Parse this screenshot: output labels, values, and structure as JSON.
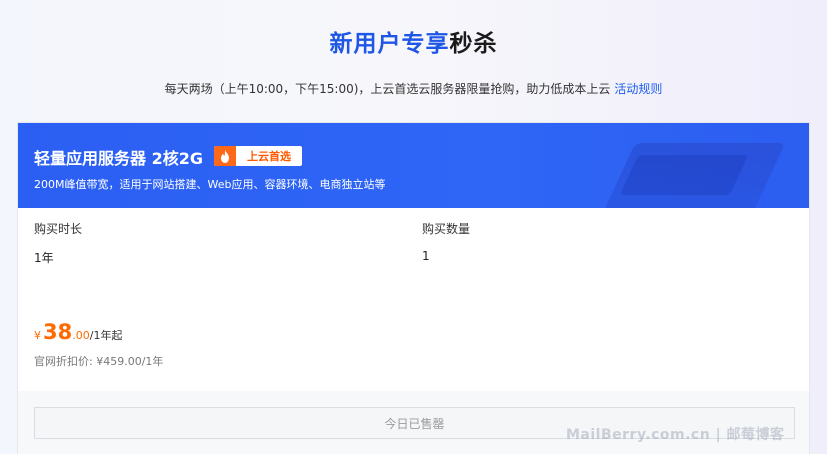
{
  "header": {
    "title_highlight": "新用户专享",
    "title_rest": "秒杀",
    "subtitle": "每天两场（上午10:00，下午15:00)，上云首选云服务器限量抢购，助力低成本上云",
    "rules_link": "活动规则"
  },
  "product": {
    "name": "轻量应用服务器 2核2G",
    "badge_icon": "flame-icon",
    "badge": "上云首选",
    "description": "200M峰值带宽，适用于网站搭建、Web应用、容器环境、电商独立站等",
    "duration_label": "购买时长",
    "duration_value": "1年",
    "quantity_label": "购买数量",
    "quantity_value": "1",
    "price_currency": "¥",
    "price_integer": "38",
    "price_decimal": ".00",
    "price_unit": "/1年起",
    "original_price": "官网折扣价: ¥459.00/1年",
    "sold_out_button": "今日已售罄"
  },
  "watermark": "MailBerry.com.cn | 邮莓博客",
  "colors": {
    "accent_blue": "#1e56e6",
    "header_blue": "#2f66f6",
    "price_orange": "#ff6a00",
    "badge_orange": "#ff6a1a"
  }
}
